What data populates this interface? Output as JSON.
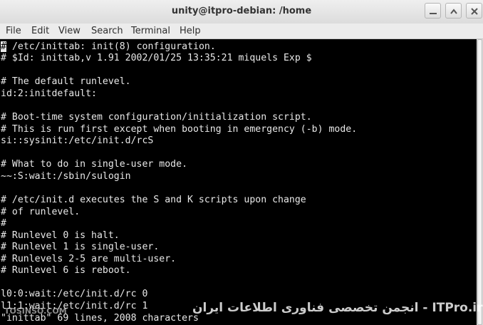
{
  "window": {
    "title": "unity@itpro-debian: /home"
  },
  "menu": {
    "file": "File",
    "edit": "Edit",
    "view": "View",
    "search": "Search",
    "terminal": "Terminal",
    "help": "Help"
  },
  "terminal": {
    "cursor_char": "#",
    "lines": [
      " /etc/inittab: init(8) configuration.",
      "# $Id: inittab,v 1.91 2002/01/25 13:35:21 miquels Exp $",
      "",
      "# The default runlevel.",
      "id:2:initdefault:",
      "",
      "# Boot-time system configuration/initialization script.",
      "# This is run first except when booting in emergency (-b) mode.",
      "si::sysinit:/etc/init.d/rcS",
      "",
      "# What to do in single-user mode.",
      "~~:S:wait:/sbin/sulogin",
      "",
      "# /etc/init.d executes the S and K scripts upon change",
      "# of runlevel.",
      "#",
      "# Runlevel 0 is halt.",
      "# Runlevel 1 is single-user.",
      "# Runlevels 2-5 are multi-user.",
      "# Runlevel 6 is reboot.",
      "",
      "l0:0:wait:/etc/init.d/rc 0",
      "l1:1:wait:/etc/init.d/rc 1",
      "\"inittab\" 69 lines, 2008 characters"
    ]
  },
  "watermark": {
    "main": "انجمن تخصصی فناوری اطلاعات ایران - ITPro.ir",
    "left": "TOSINSO.COM"
  },
  "colors": {
    "terminal_bg": "#000000",
    "terminal_fg": "#e8e8e8",
    "titlebar": "#e6e6e6"
  }
}
